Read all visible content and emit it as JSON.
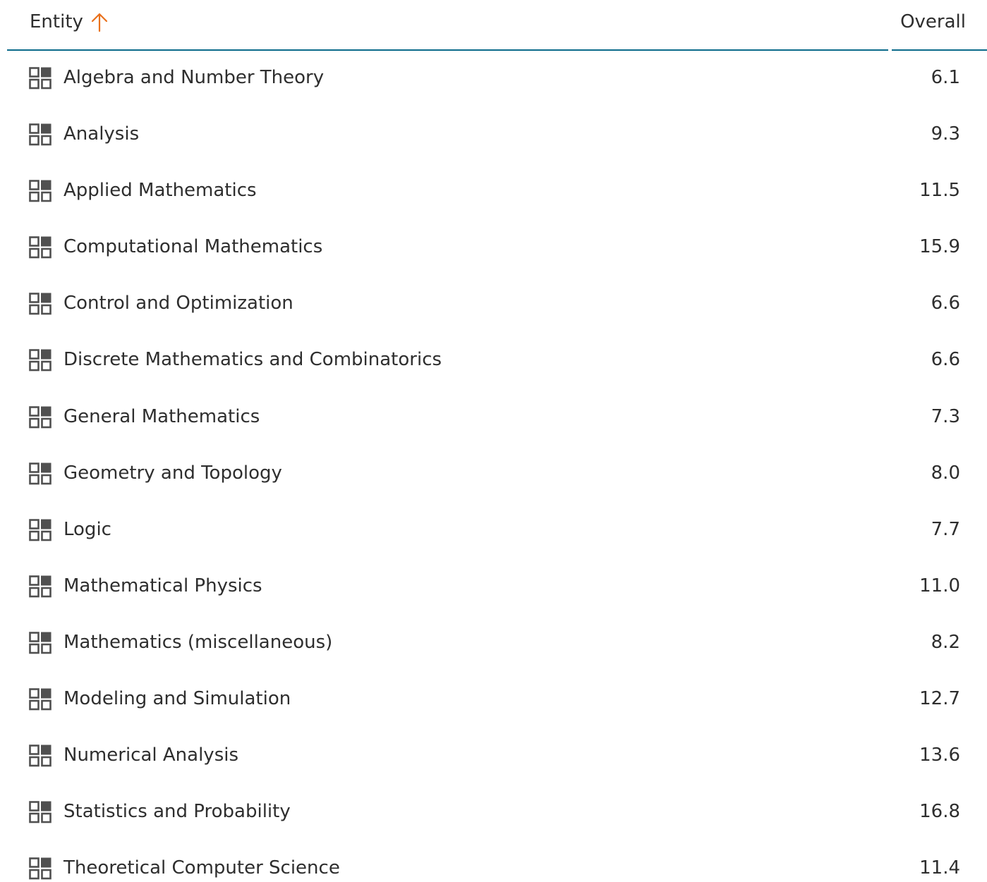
{
  "colors": {
    "accent": "#e9711c",
    "rule": "#0b6a8a",
    "text": "#2e2e2e",
    "icon": "#505050"
  },
  "header": {
    "entity_label": "Entity",
    "sort_icon": "arrow-up-icon",
    "overall_label": "Overall"
  },
  "rows": [
    {
      "label": "Algebra and Number Theory",
      "value": "6.1",
      "icon": "grid-icon"
    },
    {
      "label": "Analysis",
      "value": "9.3",
      "icon": "grid-icon"
    },
    {
      "label": "Applied Mathematics",
      "value": "11.5",
      "icon": "grid-icon"
    },
    {
      "label": "Computational Mathematics",
      "value": "15.9",
      "icon": "grid-icon"
    },
    {
      "label": "Control and Optimization",
      "value": "6.6",
      "icon": "grid-icon"
    },
    {
      "label": "Discrete Mathematics and Combinatorics",
      "value": "6.6",
      "icon": "grid-icon"
    },
    {
      "label": "General Mathematics",
      "value": "7.3",
      "icon": "grid-icon"
    },
    {
      "label": "Geometry and Topology",
      "value": "8.0",
      "icon": "grid-icon"
    },
    {
      "label": "Logic",
      "value": "7.7",
      "icon": "grid-icon"
    },
    {
      "label": "Mathematical Physics",
      "value": "11.0",
      "icon": "grid-icon"
    },
    {
      "label": "Mathematics (miscellaneous)",
      "value": "8.2",
      "icon": "grid-icon"
    },
    {
      "label": "Modeling and Simulation",
      "value": "12.7",
      "icon": "grid-icon"
    },
    {
      "label": "Numerical Analysis",
      "value": "13.6",
      "icon": "grid-icon"
    },
    {
      "label": "Statistics and Probability",
      "value": "16.8",
      "icon": "grid-icon"
    },
    {
      "label": "Theoretical Computer Science",
      "value": "11.4",
      "icon": "grid-icon"
    }
  ]
}
